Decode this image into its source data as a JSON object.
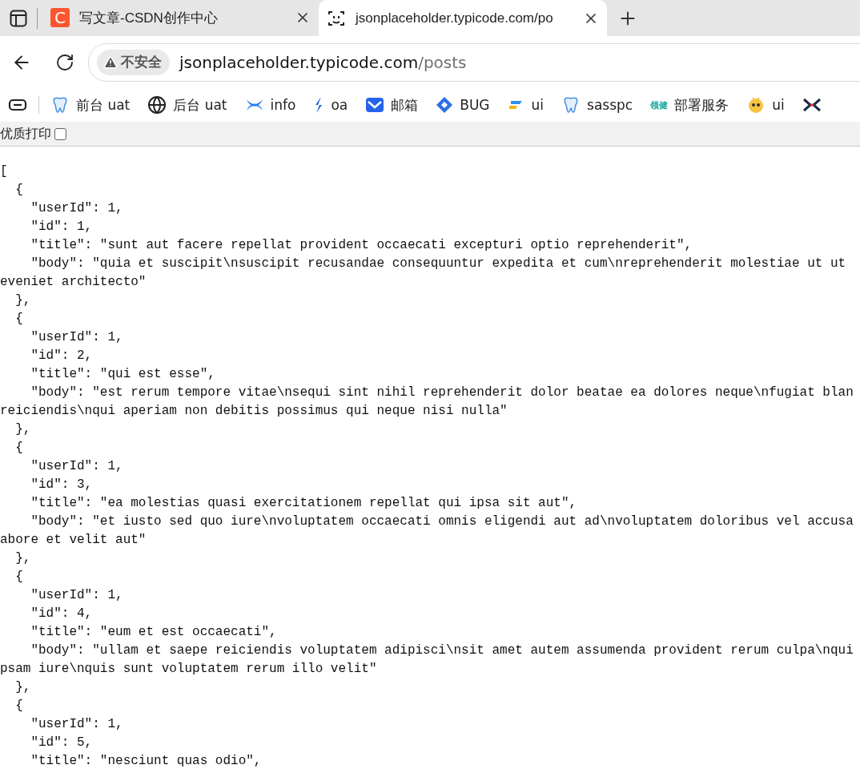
{
  "tabs": [
    {
      "favicon_letter": "C",
      "title": "写文章-CSDN创作中心",
      "selected": false
    },
    {
      "title": "jsonplaceholder.typicode.com/po",
      "selected": true
    }
  ],
  "address_bar": {
    "security_label": "不安全",
    "host": "jsonplaceholder.typicode.com",
    "path": "/posts"
  },
  "bookmarks": [
    {
      "label": "前台 uat"
    },
    {
      "label": "后台 uat"
    },
    {
      "label": "info"
    },
    {
      "label": "oa"
    },
    {
      "label": "邮箱"
    },
    {
      "label": "BUG"
    },
    {
      "label": "ui"
    },
    {
      "label": "sasspc"
    },
    {
      "logo_text": "领健",
      "label": "部署服务"
    },
    {
      "label": "ui"
    }
  ],
  "print_bar": {
    "label": "优质打印",
    "checked": false
  },
  "document": {
    "lines": [
      "[",
      "  {",
      "    \"userId\": 1,",
      "    \"id\": 1,",
      "    \"title\": \"sunt aut facere repellat provident occaecati excepturi optio reprehenderit\",",
      "    \"body\": \"quia et suscipit\\nsuscipit recusandae consequuntur expedita et cum\\nreprehenderit molestiae ut ut",
      "eveniet architecto\"",
      "  },",
      "  {",
      "    \"userId\": 1,",
      "    \"id\": 2,",
      "    \"title\": \"qui est esse\",",
      "    \"body\": \"est rerum tempore vitae\\nsequi sint nihil reprehenderit dolor beatae ea dolores neque\\nfugiat blan",
      "reiciendis\\nqui aperiam non debitis possimus qui neque nisi nulla\"",
      "  },",
      "  {",
      "    \"userId\": 1,",
      "    \"id\": 3,",
      "    \"title\": \"ea molestias quasi exercitationem repellat qui ipsa sit aut\",",
      "    \"body\": \"et iusto sed quo iure\\nvoluptatem occaecati omnis eligendi aut ad\\nvoluptatem doloribus vel accusa",
      "abore et velit aut\"",
      "  },",
      "  {",
      "    \"userId\": 1,",
      "    \"id\": 4,",
      "    \"title\": \"eum et est occaecati\",",
      "    \"body\": \"ullam et saepe reiciendis voluptatem adipisci\\nsit amet autem assumenda provident rerum culpa\\nqui",
      "psam iure\\nquis sunt voluptatem rerum illo velit\"",
      "  },",
      "  {",
      "    \"userId\": 1,",
      "    \"id\": 5,",
      "    \"title\": \"nesciunt quas odio\","
    ]
  }
}
